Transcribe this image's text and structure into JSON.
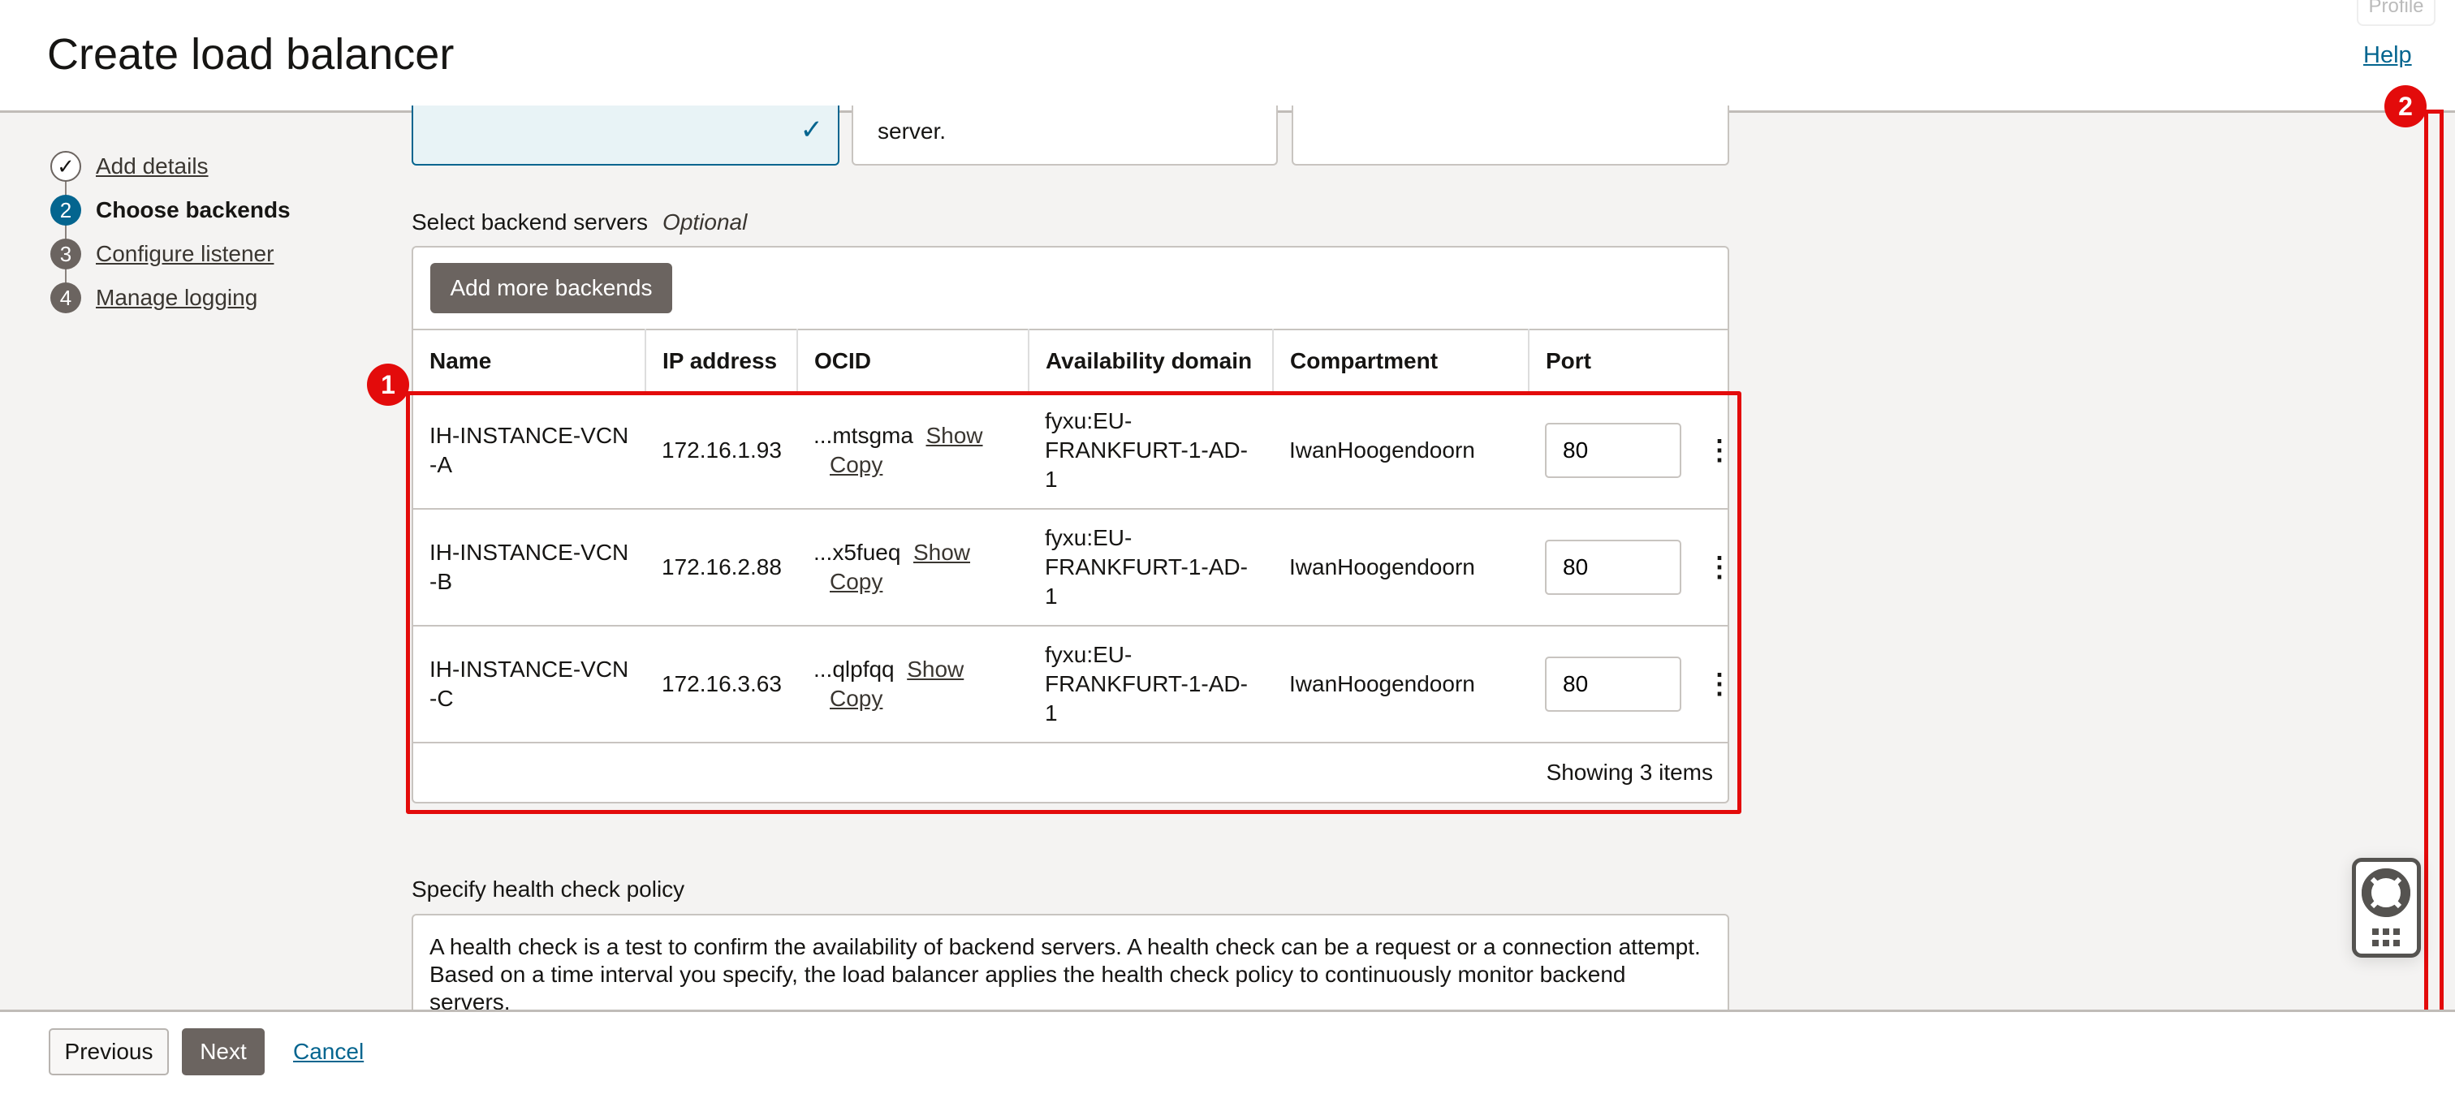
{
  "header": {
    "title": "Create load balancer",
    "help": "Help",
    "profile": "Profile"
  },
  "steps": [
    {
      "num": "✓",
      "label": "Add details",
      "state": "done"
    },
    {
      "num": "2",
      "label": "Choose backends",
      "state": "current"
    },
    {
      "num": "3",
      "label": "Configure listener",
      "state": "todo"
    },
    {
      "num": "4",
      "label": "Manage logging",
      "state": "todo"
    }
  ],
  "cards": {
    "card2_text": "server."
  },
  "backends": {
    "label": "Select backend servers",
    "optional": "Optional",
    "add_button": "Add more backends",
    "columns": [
      "Name",
      "IP address",
      "OCID",
      "Availability domain",
      "Compartment",
      "Port"
    ],
    "rows": [
      {
        "name": "IH-INSTANCE-VCN -A",
        "ip": "172.16.1.93",
        "ocid": "...mtsgma",
        "show": "Show",
        "copy": "Copy",
        "ad": "fyxu:EU- FRANKFURT-1-AD-1",
        "compartment": "IwanHoogendoorn",
        "port": "80"
      },
      {
        "name": "IH-INSTANCE-VCN -B",
        "ip": "172.16.2.88",
        "ocid": "...x5fueq",
        "show": "Show",
        "copy": "Copy",
        "ad": "fyxu:EU- FRANKFURT-1-AD-1",
        "compartment": "IwanHoogendoorn",
        "port": "80"
      },
      {
        "name": "IH-INSTANCE-VCN -C",
        "ip": "172.16.3.63",
        "ocid": "...qlpfqq",
        "show": "Show",
        "copy": "Copy",
        "ad": "fyxu:EU- FRANKFURT-1-AD-1",
        "compartment": "IwanHoogendoorn",
        "port": "80"
      }
    ],
    "footer": "Showing 3 items"
  },
  "health": {
    "label": "Specify health check policy",
    "text": "A health check is a test to confirm the availability of backend servers. A health check can be a request or a connection attempt. Based on a time interval you specify, the load balancer applies the health check policy to continuously monitor backend servers."
  },
  "footer": {
    "previous": "Previous",
    "next": "Next",
    "cancel": "Cancel"
  },
  "annotations": {
    "badge1": "1",
    "badge2": "2",
    "color": "#e30b0b"
  },
  "colors": {
    "accent": "#04658f",
    "button": "#6b6460"
  }
}
